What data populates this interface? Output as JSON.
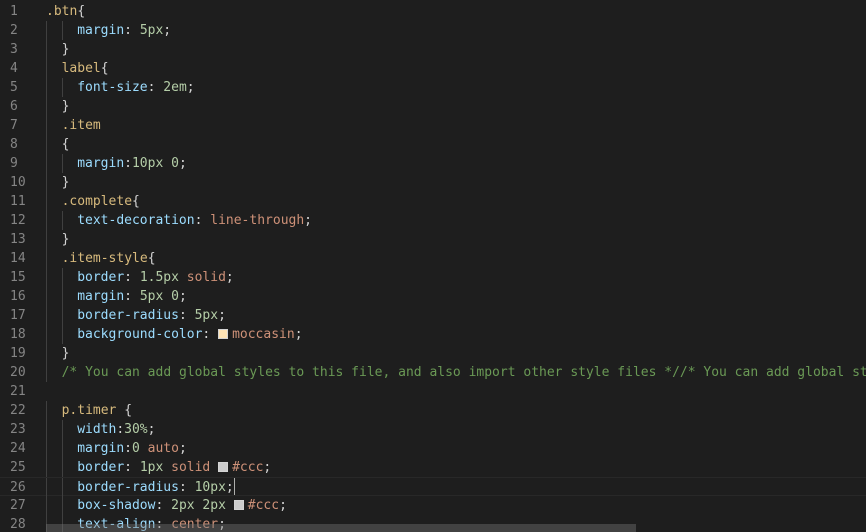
{
  "editor": {
    "colors": {
      "background": "#1e1e1e",
      "selector": "#d7ba7d",
      "property": "#9cdcfe",
      "number": "#b5cea8",
      "value": "#ce9178",
      "comment": "#6a9955",
      "line_number": "#858585"
    },
    "current_line": 26,
    "lines": [
      {
        "n": "1",
        "indent": 0,
        "tokens": [
          [
            "sel",
            ".btn"
          ],
          [
            "punc",
            "{"
          ]
        ]
      },
      {
        "n": "2",
        "indent": 2,
        "tokens": [
          [
            "prop",
            "margin"
          ],
          [
            "punc",
            ": "
          ],
          [
            "num",
            "5px"
          ],
          [
            "punc",
            ";"
          ]
        ]
      },
      {
        "n": "3",
        "indent": 1,
        "tokens": [
          [
            "punc",
            "}"
          ]
        ]
      },
      {
        "n": "4",
        "indent": 1,
        "tokens": [
          [
            "sel",
            "label"
          ],
          [
            "punc",
            "{"
          ]
        ]
      },
      {
        "n": "5",
        "indent": 2,
        "tokens": [
          [
            "prop",
            "font-size"
          ],
          [
            "punc",
            ": "
          ],
          [
            "num",
            "2em"
          ],
          [
            "punc",
            ";"
          ]
        ]
      },
      {
        "n": "6",
        "indent": 1,
        "tokens": [
          [
            "punc",
            "}"
          ]
        ]
      },
      {
        "n": "7",
        "indent": 1,
        "tokens": [
          [
            "sel",
            ".item"
          ]
        ]
      },
      {
        "n": "8",
        "indent": 1,
        "tokens": [
          [
            "punc",
            "{"
          ]
        ]
      },
      {
        "n": "9",
        "indent": 2,
        "tokens": [
          [
            "prop",
            "margin"
          ],
          [
            "punc",
            ":"
          ],
          [
            "num",
            "10px 0"
          ],
          [
            "punc",
            ";"
          ]
        ]
      },
      {
        "n": "10",
        "indent": 1,
        "tokens": [
          [
            "punc",
            "}"
          ]
        ]
      },
      {
        "n": "11",
        "indent": 1,
        "tokens": [
          [
            "sel",
            ".complete"
          ],
          [
            "punc",
            "{"
          ]
        ]
      },
      {
        "n": "12",
        "indent": 2,
        "tokens": [
          [
            "prop",
            "text-decoration"
          ],
          [
            "punc",
            ": "
          ],
          [
            "val",
            "line-through"
          ],
          [
            "punc",
            ";"
          ]
        ]
      },
      {
        "n": "13",
        "indent": 1,
        "tokens": [
          [
            "punc",
            "}"
          ]
        ]
      },
      {
        "n": "14",
        "indent": 1,
        "tokens": [
          [
            "sel",
            ".item-style"
          ],
          [
            "punc",
            "{"
          ]
        ]
      },
      {
        "n": "15",
        "indent": 2,
        "tokens": [
          [
            "prop",
            "border"
          ],
          [
            "punc",
            ": "
          ],
          [
            "num",
            "1.5px"
          ],
          [
            "punc",
            " "
          ],
          [
            "val",
            "solid"
          ],
          [
            "punc",
            ";"
          ]
        ]
      },
      {
        "n": "16",
        "indent": 2,
        "tokens": [
          [
            "prop",
            "margin"
          ],
          [
            "punc",
            ": "
          ],
          [
            "num",
            "5px 0"
          ],
          [
            "punc",
            ";"
          ]
        ]
      },
      {
        "n": "17",
        "indent": 2,
        "tokens": [
          [
            "prop",
            "border-radius"
          ],
          [
            "punc",
            ": "
          ],
          [
            "num",
            "5px"
          ],
          [
            "punc",
            ";"
          ]
        ]
      },
      {
        "n": "18",
        "indent": 2,
        "tokens": [
          [
            "prop",
            "background-color"
          ],
          [
            "punc",
            ": "
          ],
          [
            "swatch",
            "#ffe4b5"
          ],
          [
            "val",
            "moccasin"
          ],
          [
            "punc",
            ";"
          ]
        ]
      },
      {
        "n": "19",
        "indent": 1,
        "tokens": [
          [
            "punc",
            "}"
          ]
        ]
      },
      {
        "n": "20",
        "indent": 1,
        "tokens": [
          [
            "cmt",
            "/* You can add global styles to this file, and also import other style files *//* You can add global styles to this file, and also import other style files */"
          ]
        ]
      },
      {
        "n": "21",
        "indent": 0,
        "tokens": []
      },
      {
        "n": "22",
        "indent": 1,
        "tokens": [
          [
            "sel",
            "p.timer"
          ],
          [
            "punc",
            " {"
          ]
        ]
      },
      {
        "n": "23",
        "indent": 2,
        "tokens": [
          [
            "prop",
            "width"
          ],
          [
            "punc",
            ":"
          ],
          [
            "num",
            "30%"
          ],
          [
            "punc",
            ";"
          ]
        ]
      },
      {
        "n": "24",
        "indent": 2,
        "tokens": [
          [
            "prop",
            "margin"
          ],
          [
            "punc",
            ":"
          ],
          [
            "num",
            "0"
          ],
          [
            "punc",
            " "
          ],
          [
            "val",
            "auto"
          ],
          [
            "punc",
            ";"
          ]
        ]
      },
      {
        "n": "25",
        "indent": 2,
        "tokens": [
          [
            "prop",
            "border"
          ],
          [
            "punc",
            ": "
          ],
          [
            "num",
            "1px"
          ],
          [
            "punc",
            " "
          ],
          [
            "val",
            "solid"
          ],
          [
            "punc",
            " "
          ],
          [
            "swatch",
            "#cccccc"
          ],
          [
            "val",
            "#ccc"
          ],
          [
            "punc",
            ";"
          ]
        ]
      },
      {
        "n": "26",
        "indent": 2,
        "tokens": [
          [
            "prop",
            "border-radius"
          ],
          [
            "punc",
            ": "
          ],
          [
            "num",
            "10px"
          ],
          [
            "punc",
            ";"
          ],
          [
            "cursor",
            ""
          ]
        ]
      },
      {
        "n": "27",
        "indent": 2,
        "tokens": [
          [
            "prop",
            "box-shadow"
          ],
          [
            "punc",
            ": "
          ],
          [
            "num",
            "2px 2px"
          ],
          [
            "punc",
            " "
          ],
          [
            "swatch",
            "#cccccc"
          ],
          [
            "val",
            "#ccc"
          ],
          [
            "punc",
            ";"
          ]
        ]
      },
      {
        "n": "28",
        "indent": 2,
        "tokens": [
          [
            "prop",
            "text-align"
          ],
          [
            "punc",
            ": "
          ],
          [
            "val",
            "center"
          ],
          [
            "punc",
            ";"
          ]
        ]
      }
    ],
    "scrollbar": {
      "thumb_fraction": 0.72
    }
  }
}
